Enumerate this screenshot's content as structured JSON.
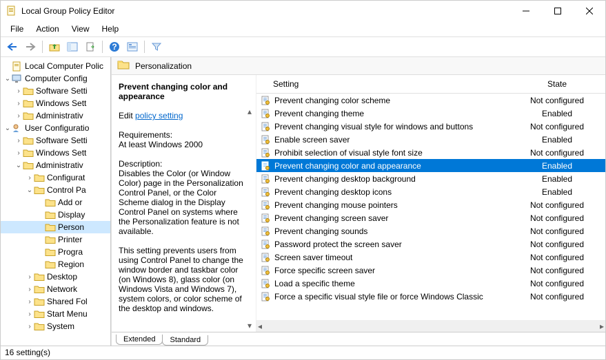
{
  "window": {
    "title": "Local Group Policy Editor"
  },
  "menu": {
    "file": "File",
    "action": "Action",
    "view": "View",
    "help": "Help"
  },
  "pane": {
    "title": "Personalization",
    "setting_col": "Setting",
    "state_col": "State"
  },
  "desc": {
    "title": "Prevent changing color and appearance",
    "edit_prefix": "Edit",
    "edit_link": "policy setting",
    "req_label": "Requirements:",
    "req_value": "At least Windows 2000",
    "desc_label": "Description:",
    "desc_body": "Disables the Color (or Window Color) page in the Personalization Control Panel, or the Color Scheme dialog in the Display Control Panel on systems where the Personalization feature is not available.",
    "desc_body2": "This setting prevents users from using Control Panel to change the window border and taskbar color (on Windows 8), glass color (on Windows Vista and Windows 7), system colors, or color scheme of the desktop and windows."
  },
  "tree": [
    {
      "indent": 0,
      "exp": "",
      "icon": "root",
      "label": "Local Computer Polic"
    },
    {
      "indent": 0,
      "exp": "open",
      "icon": "comp",
      "label": "Computer Config"
    },
    {
      "indent": 1,
      "exp": "closed",
      "icon": "f",
      "label": "Software Setti"
    },
    {
      "indent": 1,
      "exp": "closed",
      "icon": "f",
      "label": "Windows Sett"
    },
    {
      "indent": 1,
      "exp": "closed",
      "icon": "f",
      "label": "Administrativ"
    },
    {
      "indent": 0,
      "exp": "open",
      "icon": "user",
      "label": "User Configuratio"
    },
    {
      "indent": 1,
      "exp": "closed",
      "icon": "f",
      "label": "Software Setti"
    },
    {
      "indent": 1,
      "exp": "closed",
      "icon": "f",
      "label": "Windows Sett"
    },
    {
      "indent": 1,
      "exp": "open",
      "icon": "f",
      "label": "Administrativ"
    },
    {
      "indent": 2,
      "exp": "closed",
      "icon": "f",
      "label": "Configurat"
    },
    {
      "indent": 2,
      "exp": "open",
      "icon": "f",
      "label": "Control Pa"
    },
    {
      "indent": 3,
      "exp": "",
      "icon": "f",
      "label": "Add or"
    },
    {
      "indent": 3,
      "exp": "",
      "icon": "f",
      "label": "Display"
    },
    {
      "indent": 3,
      "exp": "",
      "icon": "f",
      "label": "Person",
      "selected": true
    },
    {
      "indent": 3,
      "exp": "",
      "icon": "f",
      "label": "Printer"
    },
    {
      "indent": 3,
      "exp": "",
      "icon": "f",
      "label": "Progra"
    },
    {
      "indent": 3,
      "exp": "",
      "icon": "f",
      "label": "Region"
    },
    {
      "indent": 2,
      "exp": "closed",
      "icon": "f",
      "label": "Desktop"
    },
    {
      "indent": 2,
      "exp": "closed",
      "icon": "f",
      "label": "Network"
    },
    {
      "indent": 2,
      "exp": "closed",
      "icon": "f",
      "label": "Shared Fol"
    },
    {
      "indent": 2,
      "exp": "closed",
      "icon": "f",
      "label": "Start Menu"
    },
    {
      "indent": 2,
      "exp": "closed",
      "icon": "f",
      "label": "System"
    }
  ],
  "settings": [
    {
      "name": "Prevent changing color scheme",
      "state": "Not configured"
    },
    {
      "name": "Prevent changing theme",
      "state": "Enabled"
    },
    {
      "name": "Prevent changing visual style for windows and buttons",
      "state": "Not configured"
    },
    {
      "name": "Enable screen saver",
      "state": "Enabled"
    },
    {
      "name": "Prohibit selection of visual style font size",
      "state": "Not configured"
    },
    {
      "name": "Prevent changing color and appearance",
      "state": "Enabled",
      "selected": true
    },
    {
      "name": "Prevent changing desktop background",
      "state": "Enabled"
    },
    {
      "name": "Prevent changing desktop icons",
      "state": "Enabled"
    },
    {
      "name": "Prevent changing mouse pointers",
      "state": "Not configured"
    },
    {
      "name": "Prevent changing screen saver",
      "state": "Not configured"
    },
    {
      "name": "Prevent changing sounds",
      "state": "Not configured"
    },
    {
      "name": "Password protect the screen saver",
      "state": "Not configured"
    },
    {
      "name": "Screen saver timeout",
      "state": "Not configured"
    },
    {
      "name": "Force specific screen saver",
      "state": "Not configured"
    },
    {
      "name": "Load a specific theme",
      "state": "Not configured"
    },
    {
      "name": "Force a specific visual style file or force Windows Classic",
      "state": "Not configured"
    }
  ],
  "tabs": {
    "extended": "Extended",
    "standard": "Standard"
  },
  "status": {
    "text": "16 setting(s)"
  }
}
